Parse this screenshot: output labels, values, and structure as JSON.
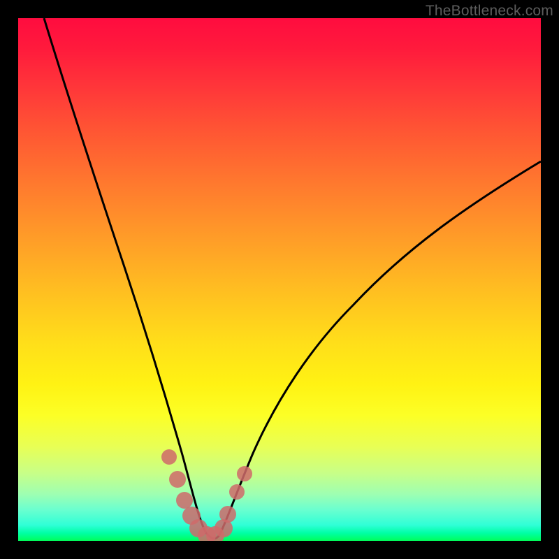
{
  "watermark": "TheBottleneck.com",
  "chart_data": {
    "type": "line",
    "title": "",
    "xlabel": "",
    "ylabel": "",
    "xlim": [
      0,
      100
    ],
    "ylim": [
      0,
      100
    ],
    "note": "Axes reconstructed as 0–100 percentage scales; curve is a V-shaped bottleneck profile with minimum near x≈35 and y≈0.",
    "series": [
      {
        "name": "bottleneck-curve",
        "color": "#000000",
        "x": [
          5,
          8,
          12,
          16,
          20,
          24,
          27,
          30,
          32,
          34,
          36,
          38,
          40,
          43,
          47,
          52,
          58,
          65,
          73,
          82,
          92,
          100
        ],
        "y": [
          100,
          90,
          77,
          64,
          51,
          38,
          28,
          18,
          10,
          4,
          1,
          1,
          3,
          7,
          13,
          20,
          27,
          34,
          41,
          48,
          55,
          60
        ]
      },
      {
        "name": "highlight-markers",
        "color": "#cf6a6a",
        "x": [
          28.5,
          30.0,
          31.5,
          33.0,
          34.5,
          36.0,
          37.5,
          39.0,
          40.0,
          41.5,
          43.0
        ],
        "y": [
          16.5,
          12.0,
          8.0,
          5.0,
          2.5,
          1.5,
          2.0,
          4.0,
          7.0,
          10.0,
          13.0
        ]
      }
    ],
    "background_gradient": {
      "top": "#ff0c3f",
      "mid": "#ffde1a",
      "bottom": "#00ff5a"
    }
  }
}
